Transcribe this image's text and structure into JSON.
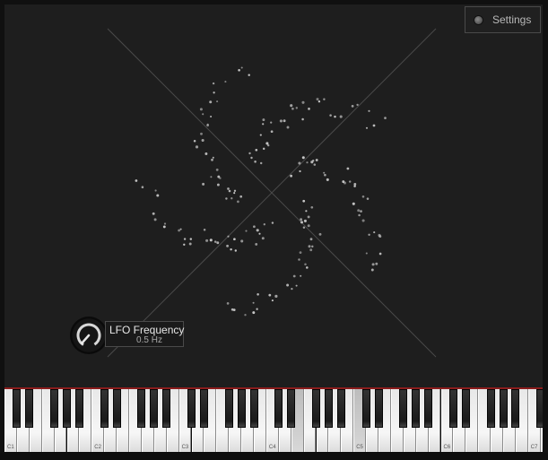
{
  "settings": {
    "label": "Settings"
  },
  "lfo": {
    "title": "LFO Frequency",
    "value": "0.5 Hz"
  },
  "keyboard": {
    "octave_labels": [
      "C1",
      "C2",
      "C3",
      "C4",
      "C5",
      "C6",
      "C7"
    ],
    "pressed_keys": [
      "E4",
      "C5"
    ],
    "accent": "#8c1c1c"
  },
  "colors": {
    "background": "#1e1e1e",
    "trace": "#c8c8c8",
    "crosshair": "#4a4a4a"
  },
  "icons": {
    "settings_led": "status-led-icon",
    "lfo_knob": "knob-icon"
  }
}
